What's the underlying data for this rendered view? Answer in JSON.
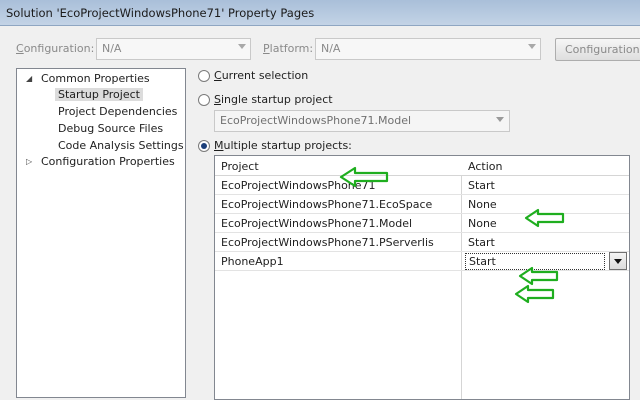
{
  "window": {
    "title": "Solution 'EcoProjectWindowsPhone71' Property Pages"
  },
  "toolbar": {
    "configuration_label": "Configuration:",
    "configuration_value": "N/A",
    "platform_label": "Platform:",
    "platform_value": "N/A",
    "configuration_manager_label": "Configuration Manager..."
  },
  "tree": {
    "common_properties": "Common Properties",
    "startup_project": "Startup Project",
    "project_dependencies": "Project Dependencies",
    "debug_source_files": "Debug Source Files",
    "code_analysis_settings": "Code Analysis Settings",
    "configuration_properties": "Configuration Properties"
  },
  "startup": {
    "current_selection": "Current selection",
    "single_startup_project": "Single startup project",
    "single_value": "EcoProjectWindowsPhone71.Model",
    "multiple_startup_projects": "Multiple startup projects:",
    "selected_mode": "multiple"
  },
  "grid": {
    "col_project": "Project",
    "col_action": "Action",
    "rows": [
      {
        "project": "EcoProjectWindowsPhone71",
        "action": "Start"
      },
      {
        "project": "EcoProjectWindowsPhone71.EcoSpace",
        "action": "None"
      },
      {
        "project": "EcoProjectWindowsPhone71.Model",
        "action": "None"
      },
      {
        "project": "EcoProjectWindowsPhone71.PServerIis",
        "action": "Start"
      },
      {
        "project": "PhoneApp1",
        "action": "Start"
      }
    ]
  },
  "annotation_color": "#1fae1f"
}
